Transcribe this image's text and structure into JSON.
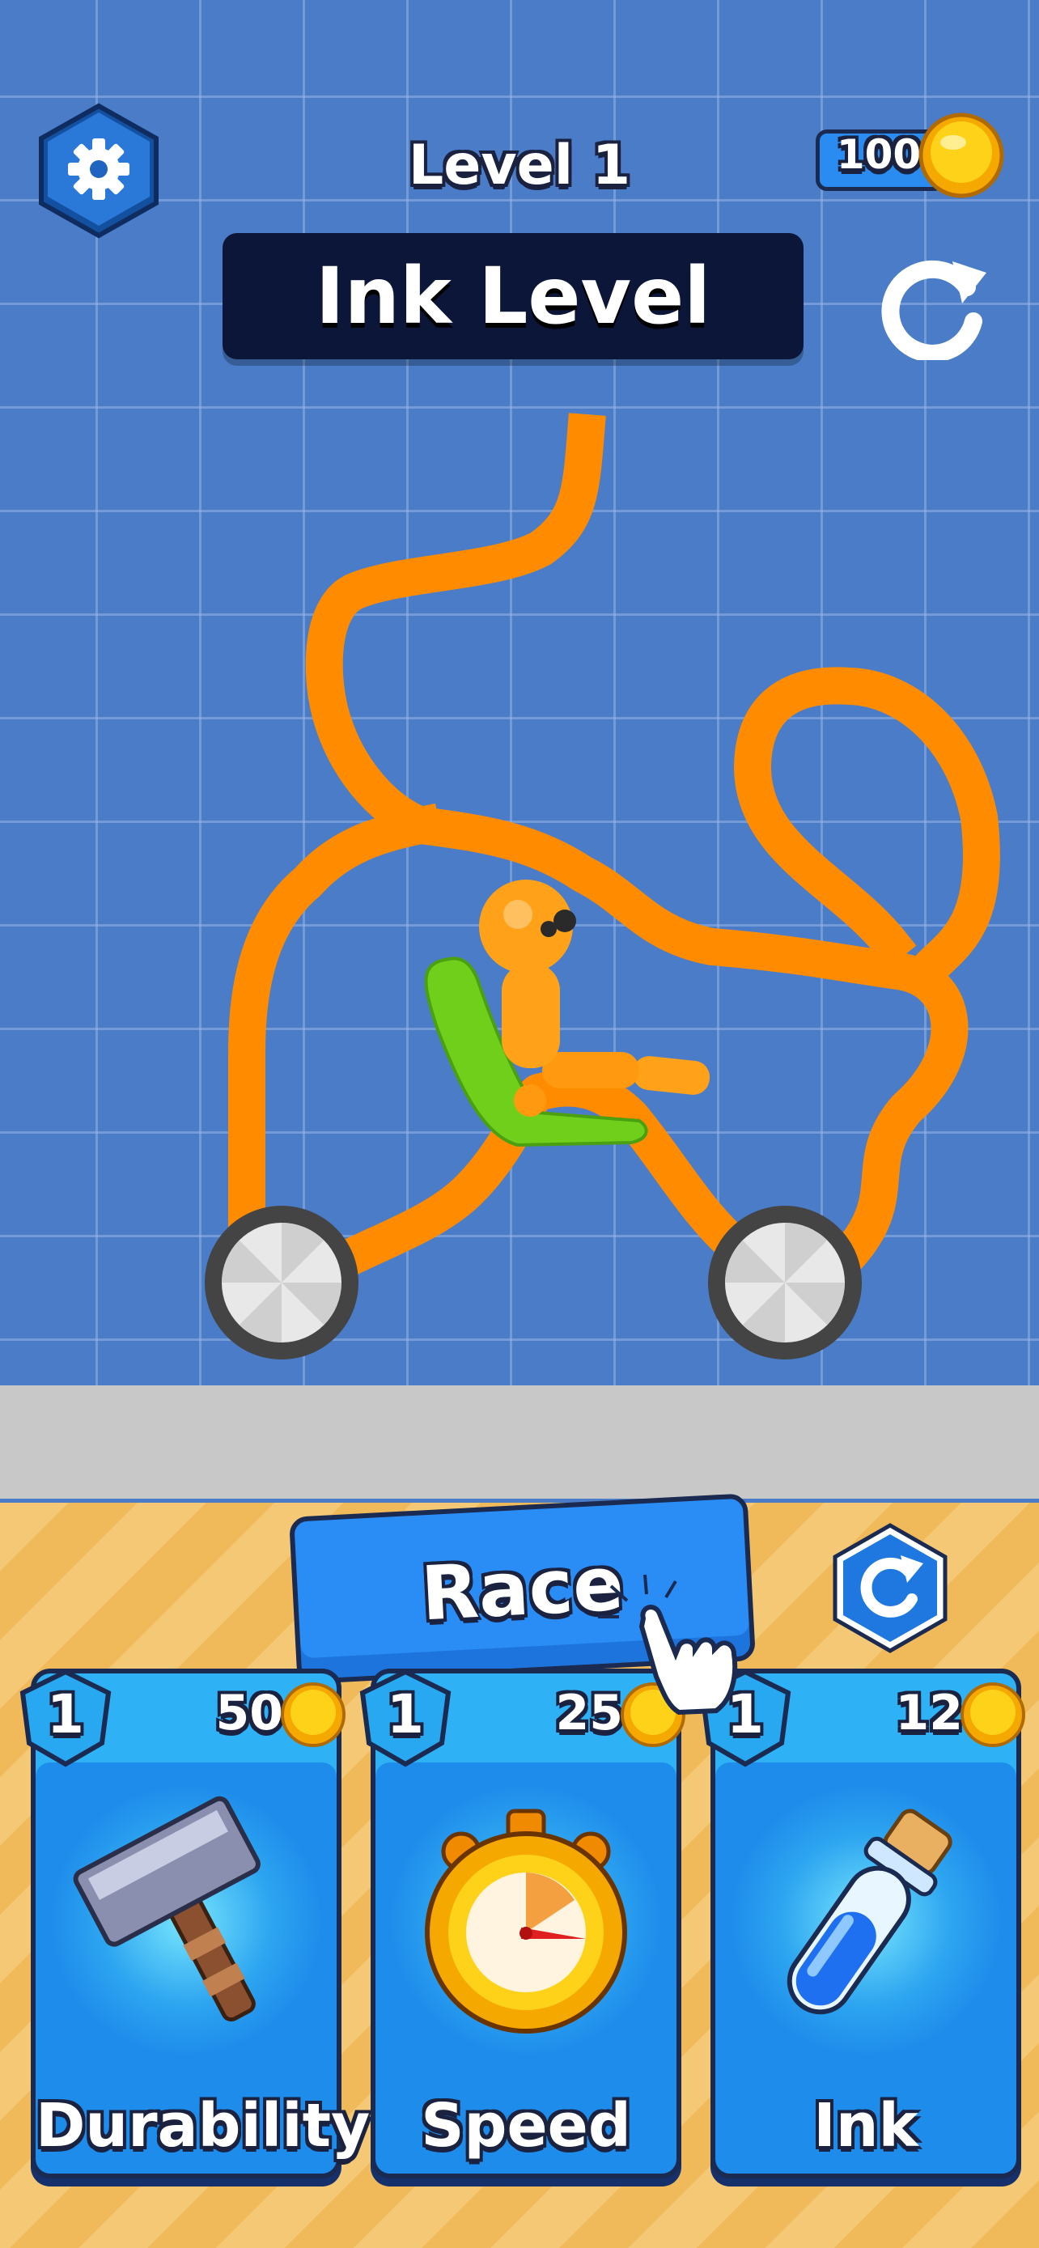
{
  "header": {
    "level_label": "Level 1",
    "coins": "100",
    "title": "Ink Level"
  },
  "actions": {
    "race_label": "Race"
  },
  "upgrades": [
    {
      "name": "Durability",
      "level": "1",
      "price": "50",
      "icon": "hammer-icon"
    },
    {
      "name": "Speed",
      "level": "1",
      "price": "25",
      "icon": "stopwatch-icon"
    },
    {
      "name": "Ink",
      "level": "1",
      "price": "12",
      "icon": "ink-vial-icon"
    }
  ],
  "colors": {
    "background": "#4a7cc8",
    "ink": "#ff8c00",
    "ground": "#c8c8c8",
    "button_blue": "#2a8cf5",
    "panel_dark": "#0c1638",
    "shop_stripe": "#f4c874"
  }
}
